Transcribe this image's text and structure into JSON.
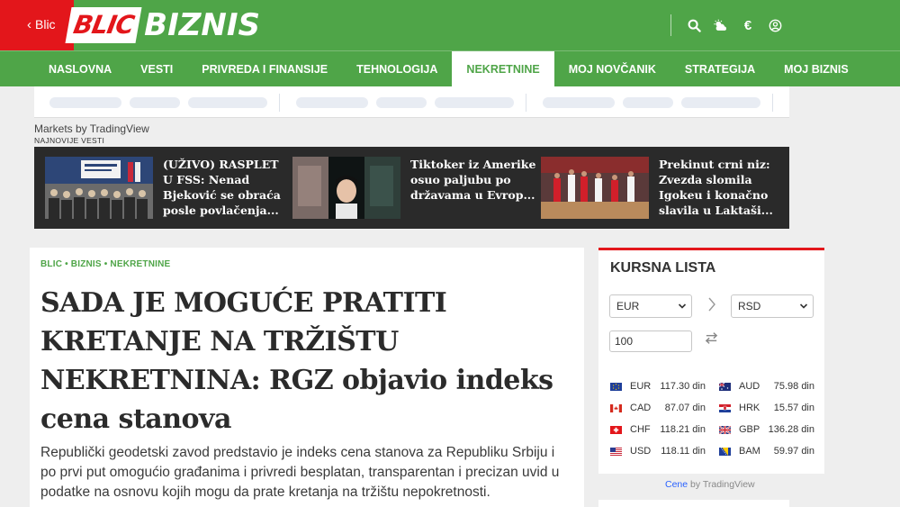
{
  "header": {
    "back_label": "Blic",
    "logo_blic": "BLIC",
    "logo_biznis": "BIZNIS",
    "icons": [
      "search-icon",
      "weather-icon",
      "euro-icon",
      "user-icon"
    ],
    "euro_glyph": "€"
  },
  "nav": {
    "items": [
      {
        "label": "NASLOVNA"
      },
      {
        "label": "VESTI"
      },
      {
        "label": "PRIVREDA I FINANSIJE"
      },
      {
        "label": "TEHNOLOGIJA"
      },
      {
        "label": "NEKRETNINE",
        "active": true
      },
      {
        "label": "MOJ NOVČANIK"
      },
      {
        "label": "STRATEGIJA"
      },
      {
        "label": "MOJ BIZNIS"
      }
    ]
  },
  "ticker": {
    "label": "Markets by TradingView"
  },
  "latest": {
    "label": "NAJNOVIJE VESTI",
    "items": [
      {
        "title": "(UŽIVO) RASPLET U FSS: Nenad Bjeković se obraća posle povlačenja..."
      },
      {
        "title": "Tiktoker iz Amerike osuo paljubu po državama u Evrop..."
      },
      {
        "title": "Prekinut crni niz: Zvezda slomila Igokeu i konačno slavila u Laktaši..."
      }
    ]
  },
  "article": {
    "breadcrumb": "BLIC • BIZNIS • NEKRETNINE",
    "headline": "SADA JE MOGUĆE PRATITI KRETANJE NA TRŽIŠTU NEKRETNINA: RGZ objavio indeks cena stanova",
    "lead": "Republički geodetski zavod predstavio je indeks cena stanova za Republiku Srbiju i po prvi put omogućio građanima i privredi besplatan, transparentan i precizan uvid u podatke na osnovu kojih mogu da prate kretanja na tržištu nepokretnosti."
  },
  "fx": {
    "title": "KURSNA LISTA",
    "from": "EUR",
    "to": "RSD",
    "amount": "100",
    "rates": [
      {
        "code": "EUR",
        "value": "117.30 din"
      },
      {
        "code": "AUD",
        "value": "75.98 din"
      },
      {
        "code": "CAD",
        "value": "87.07 din"
      },
      {
        "code": "HRK",
        "value": "15.57 din"
      },
      {
        "code": "CHF",
        "value": "118.21 din"
      },
      {
        "code": "GBP",
        "value": "136.28 din"
      },
      {
        "code": "USD",
        "value": "118.11 din"
      },
      {
        "code": "BAM",
        "value": "59.97 din"
      }
    ],
    "credit_link": "Cene",
    "credit_text": " by TradingView"
  },
  "colors": {
    "brand_green": "#4fa548",
    "brand_red": "#e3161b"
  }
}
